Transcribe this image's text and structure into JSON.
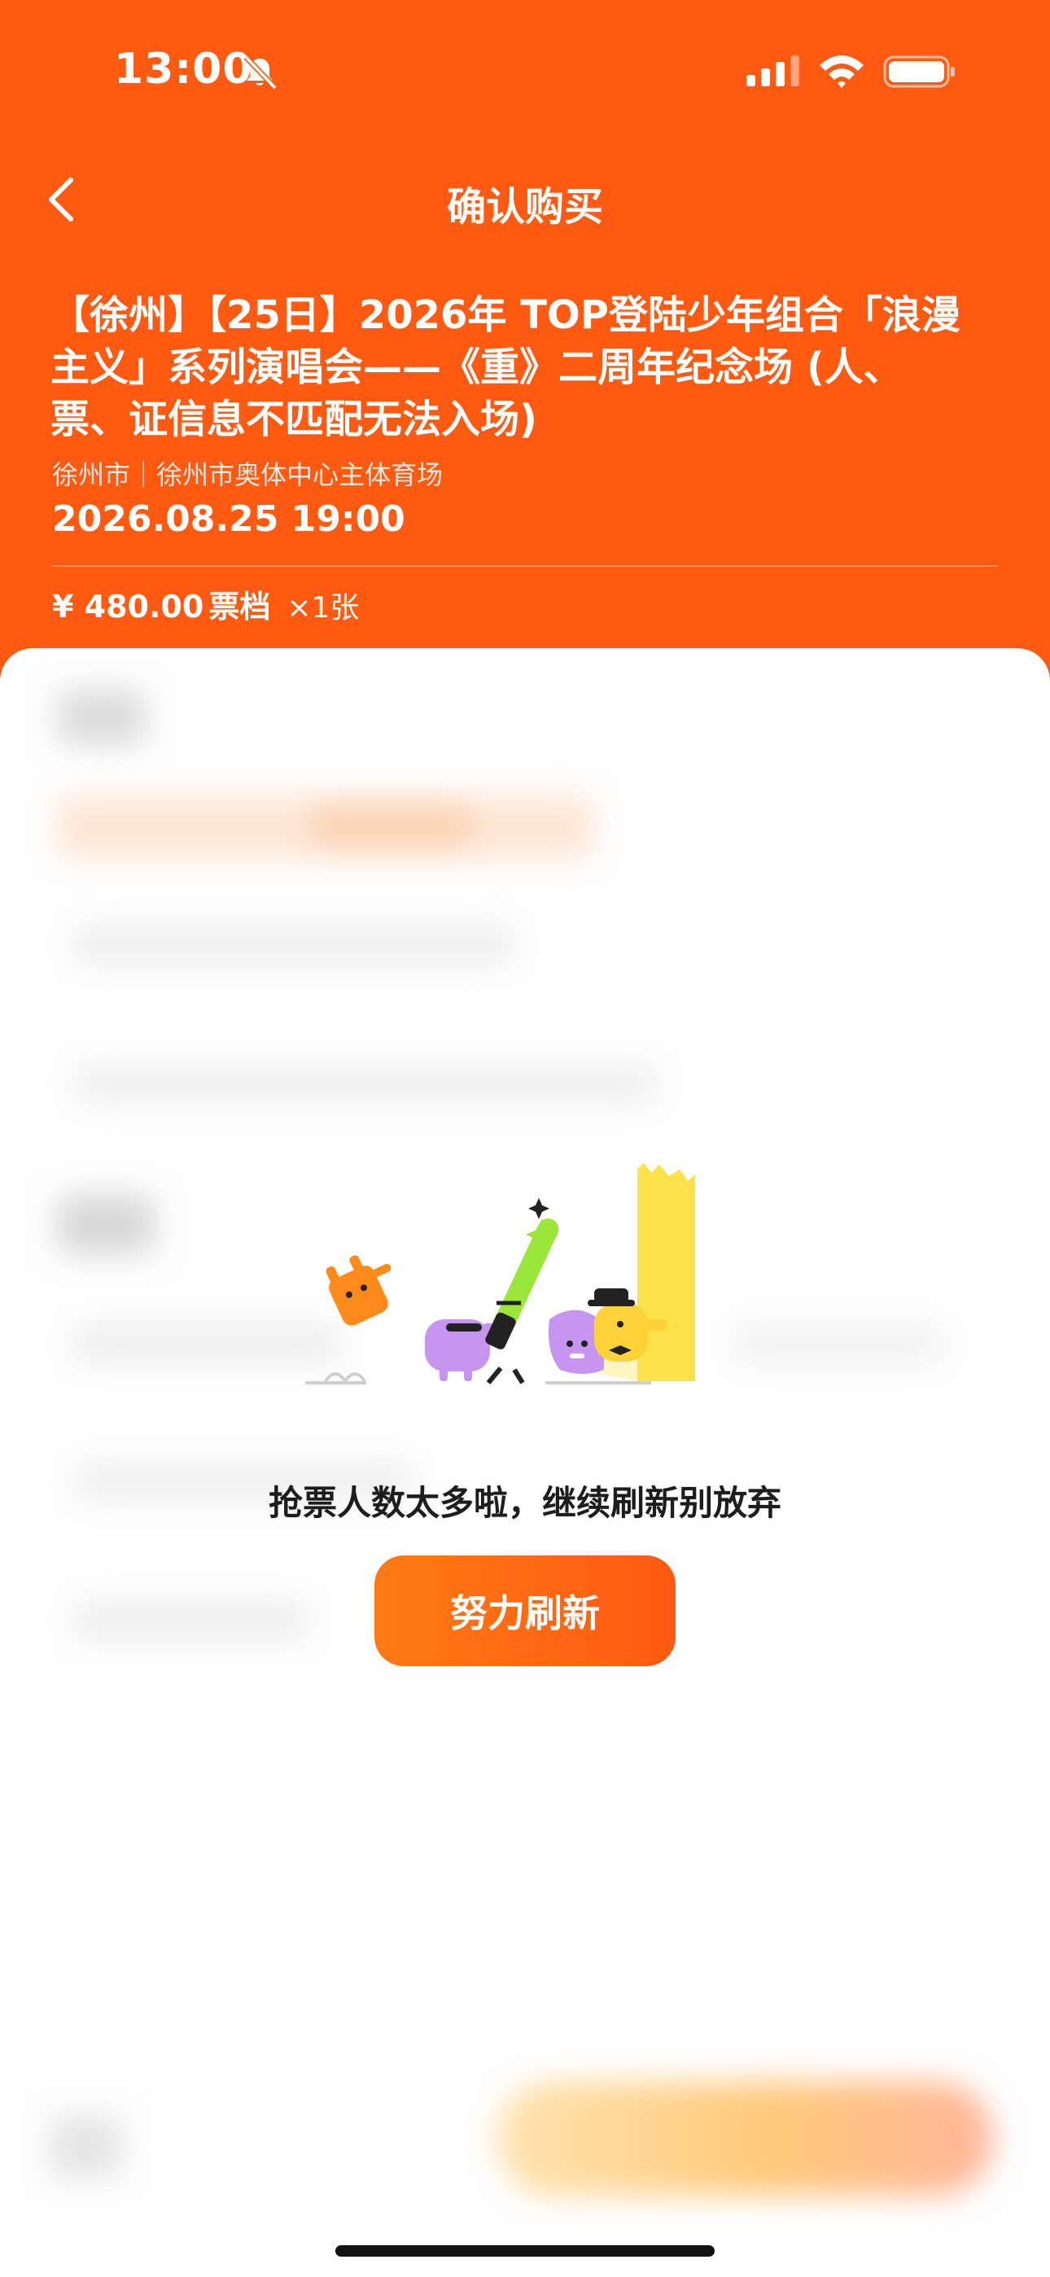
{
  "status_bar": {
    "time": "13:00",
    "icons": [
      "bell-slash-icon",
      "cellular-signal-icon",
      "wifi-icon",
      "battery-icon"
    ]
  },
  "nav": {
    "back_icon": "chevron-left-icon",
    "title": "确认购买"
  },
  "event": {
    "title_lines": [
      "【徐州】【25日】2026年 TOP登陆少年组合「浪漫",
      "主义」系列演唱会——《重》二周年纪念场 (人、",
      "票、证信息不匹配无法入场)"
    ],
    "venue": "徐州市｜徐州市奥体中心主体育场",
    "datetime": "2026.08.25 19:00",
    "ticket_price": "¥ 480.00",
    "ticket_tier_label": "票档",
    "ticket_quantity": "×1张"
  },
  "empty_state": {
    "illustration_icon": "crowd-rushing-illustration",
    "message": "抢票人数太多啦，继续刷新别放弃",
    "refresh_button_label": "努力刷新"
  },
  "colors": {
    "brand_orange": "#ff5a12",
    "button_gradient_start": "#ff7a14",
    "sheet_background": "#fefefe"
  }
}
